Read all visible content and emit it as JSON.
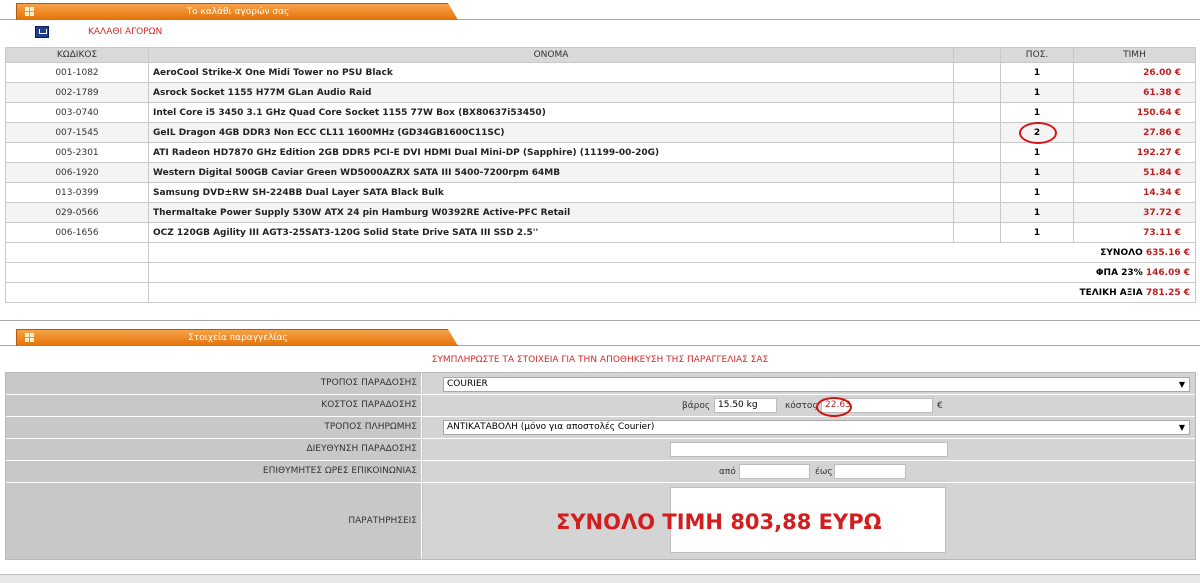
{
  "cart_tab": {
    "label": "Το καλάθι αγορών σας"
  },
  "cart_header": {
    "label": "ΚΑΛΑΘΙ ΑΓΟΡΩΝ"
  },
  "table": {
    "headers": {
      "code": "ΚΩΔΙΚΟΣ",
      "name": "ΟΝΟΜΑ",
      "qty": "ΠΟΣ.",
      "price": "ΤΙΜΗ"
    },
    "rows": [
      {
        "code": "001-1082",
        "name": "AeroCool Strike-X One Midi Tower no PSU Black",
        "qty": "1",
        "price": "26.00 €"
      },
      {
        "code": "002-1789",
        "name": "Asrock Socket 1155 H77M GLan Audio Raid",
        "qty": "1",
        "price": "61.38 €"
      },
      {
        "code": "003-0740",
        "name": "Intel Core i5 3450 3.1 GHz Quad Core Socket 1155 77W Box (BX80637i53450)",
        "qty": "1",
        "price": "150.64 €"
      },
      {
        "code": "007-1545",
        "name": "GeIL Dragon 4GB DDR3 Non ECC CL11 1600MHz (GD34GB1600C11SC)",
        "qty": "2",
        "price": "27.86 €"
      },
      {
        "code": "005-2301",
        "name": "ATI Radeon HD7870 GHz Edition 2GB DDR5 PCI-E DVI HDMI Dual Mini-DP (Sapphire) (11199-00-20G)",
        "qty": "1",
        "price": "192.27 €"
      },
      {
        "code": "006-1920",
        "name": "Western Digital 500GB Caviar Green WD5000AZRX SATA III 5400-7200rpm 64MB",
        "qty": "1",
        "price": "51.84 €"
      },
      {
        "code": "013-0399",
        "name": "Samsung DVD±RW SH-224BB Dual Layer SATA Black Bulk",
        "qty": "1",
        "price": "14.34 €"
      },
      {
        "code": "029-0566",
        "name": "Thermaltake Power Supply 530W ATX 24 pin Hamburg W0392RE Active-PFC Retail",
        "qty": "1",
        "price": "37.72 €"
      },
      {
        "code": "006-1656",
        "name": "OCZ 120GB Agility III AGT3-25SAT3-120G Solid State Drive SATA III SSD 2.5''",
        "qty": "1",
        "price": "73.11 €"
      }
    ],
    "totals": {
      "subtotal_label": "ΣΥΝΟΛΟ",
      "subtotal_value": "635.16 €",
      "vat_label": "ΦΠΑ 23%",
      "vat_value": "146.09 €",
      "total_label": "ΤΕΛΙΚΗ ΑΞΙΑ",
      "total_value": "781.25 €"
    }
  },
  "order_tab": {
    "label": "Στοιχεία παραγγελίας"
  },
  "order": {
    "instruction": "ΣΥΜΠΛΗΡΩΣΤΕ ΤΑ ΣΤΟΙΧΕΙΑ ΓΙΑ ΤΗΝ ΑΠΟΘΗΚΕΥΣΗ ΤΗΣ ΠΑΡΑΓΓΕΛΙΑΣ ΣΑΣ",
    "delivery_method_label": "ΤΡΟΠΟΣ ΠΑΡΑΔΟΣΗΣ",
    "delivery_method_value": "COURIER",
    "delivery_cost_label": "ΚΟΣΤΟΣ ΠΑΡΑΔΟΣΗΣ",
    "weight_label": "βάρος",
    "weight_value": "15.50 kg",
    "cost_label": "κόστος",
    "cost_value": "22.63",
    "currency": "€",
    "payment_method_label": "ΤΡΟΠΟΣ ΠΛΗΡΩΜΗΣ",
    "payment_method_value": "ΑΝΤΙΚΑΤΑΒΟΛΗ (μόνο για αποστολές Courier)",
    "address_label": "ΔΙΕΥΘΥΝΣΗ ΠΑΡΑΔΟΣΗΣ",
    "address_value": "",
    "contact_hours_label": "ΕΠΙΘΥΜΗΤΕΣ ΩΡΕΣ ΕΠΙΚΟΙΝΩΝΙΑΣ",
    "from_label": "από",
    "to_label": "έως",
    "from_value": "",
    "to_value": "",
    "notes_label": "ΠΑΡΑΤΗΡΗΣΕΙΣ"
  },
  "annotation": {
    "total_note": "ΣΥΝΟΛΟ ΤΙΜΗ 803,88 ΕΥΡΩ"
  }
}
